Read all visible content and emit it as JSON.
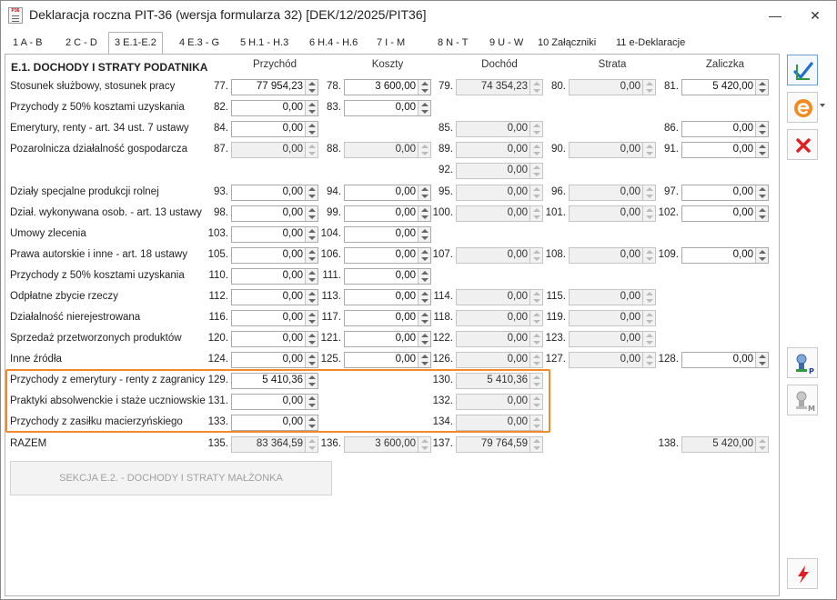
{
  "window": {
    "title": "Deklaracja roczna PIT-36 (wersja formularza 32) [DEK/12/2025/PIT36]",
    "app_icon_text": "P36",
    "minimize_glyph": "—",
    "close_glyph": "✕"
  },
  "tabs": [
    "1 A - B",
    "2 C - D",
    "3 E.1-E.2",
    "4 E.3 - G",
    "5 H.1 - H.3",
    "6 H.4 - H.6",
    "7 I - M",
    "8 N - T",
    "9 U - W",
    "10 Załączniki",
    "11 e-Deklaracje"
  ],
  "active_tab": 2,
  "section_title": "E.1. DOCHODY I STRATY PODATNIKA",
  "columns": [
    "Przychód",
    "Koszty",
    "Dochód",
    "Strata",
    "Zaliczka"
  ],
  "rows": [
    {
      "label": "Stosunek służbowy, stosunek pracy",
      "c": [
        [
          "77.",
          "77 954,23",
          0
        ],
        [
          "78.",
          "3 600,00",
          0
        ],
        [
          "79.",
          "74 354,23",
          1
        ],
        [
          "80.",
          "0,00",
          1
        ],
        [
          "81.",
          "5 420,00",
          0
        ]
      ]
    },
    {
      "label": "Przychody z 50% kosztami uzyskania",
      "c": [
        [
          "82.",
          "0,00",
          0
        ],
        [
          "83.",
          "0,00",
          0
        ],
        null,
        null,
        null
      ]
    },
    {
      "label": "Emerytury, renty - art. 34 ust. 7 ustawy",
      "c": [
        [
          "84.",
          "0,00",
          0
        ],
        null,
        [
          "85.",
          "0,00",
          1
        ],
        null,
        [
          "86.",
          "0,00",
          0
        ]
      ]
    },
    {
      "label": "Pozarolnicza działalność gospodarcza",
      "c": [
        [
          "87.",
          "0,00",
          1
        ],
        [
          "88.",
          "0,00",
          1
        ],
        [
          "89.",
          "0,00",
          1
        ],
        [
          "90.",
          "0,00",
          1
        ],
        [
          "91.",
          "0,00",
          0
        ]
      ]
    },
    {
      "label": "",
      "c": [
        null,
        null,
        [
          "92.",
          "0,00",
          1
        ],
        null,
        null
      ]
    },
    {
      "label": "Działy specjalne produkcji rolnej",
      "c": [
        [
          "93.",
          "0,00",
          0
        ],
        [
          "94.",
          "0,00",
          0
        ],
        [
          "95.",
          "0,00",
          1
        ],
        [
          "96.",
          "0,00",
          1
        ],
        [
          "97.",
          "0,00",
          0
        ]
      ]
    },
    {
      "label": "Dział. wykonywana osob. - art. 13 ustawy",
      "c": [
        [
          "98.",
          "0,00",
          0
        ],
        [
          "99.",
          "0,00",
          0
        ],
        [
          "100.",
          "0,00",
          1
        ],
        [
          "101.",
          "0,00",
          1
        ],
        [
          "102.",
          "0,00",
          0
        ]
      ]
    },
    {
      "label": "Umowy zlecenia",
      "c": [
        [
          "103.",
          "0,00",
          0
        ],
        [
          "104.",
          "0,00",
          0
        ],
        null,
        null,
        null
      ]
    },
    {
      "label": "Prawa autorskie i inne - art. 18 ustawy",
      "c": [
        [
          "105.",
          "0,00",
          0
        ],
        [
          "106.",
          "0,00",
          0
        ],
        [
          "107.",
          "0,00",
          1
        ],
        [
          "108.",
          "0,00",
          1
        ],
        [
          "109.",
          "0,00",
          0
        ]
      ]
    },
    {
      "label": "Przychody z 50% kosztami uzyskania",
      "c": [
        [
          "110.",
          "0,00",
          0
        ],
        [
          "111.",
          "0,00",
          0
        ],
        null,
        null,
        null
      ]
    },
    {
      "label": "Odpłatne zbycie rzeczy",
      "c": [
        [
          "112.",
          "0,00",
          0
        ],
        [
          "113.",
          "0,00",
          0
        ],
        [
          "114.",
          "0,00",
          1
        ],
        [
          "115.",
          "0,00",
          1
        ],
        null
      ]
    },
    {
      "label": "Działalność nierejestrowana",
      "c": [
        [
          "116.",
          "0,00",
          0
        ],
        [
          "117.",
          "0,00",
          0
        ],
        [
          "118.",
          "0,00",
          1
        ],
        [
          "119.",
          "0,00",
          1
        ],
        null
      ]
    },
    {
      "label": "Sprzedaż przetworzonych produktów",
      "c": [
        [
          "120.",
          "0,00",
          0
        ],
        [
          "121.",
          "0,00",
          0
        ],
        [
          "122.",
          "0,00",
          1
        ],
        [
          "123.",
          "0,00",
          1
        ],
        null
      ]
    },
    {
      "label": "Inne źródła",
      "c": [
        [
          "124.",
          "0,00",
          0
        ],
        [
          "125.",
          "0,00",
          0
        ],
        [
          "126.",
          "0,00",
          1
        ],
        [
          "127.",
          "0,00",
          1
        ],
        [
          "128.",
          "0,00",
          0
        ]
      ]
    },
    {
      "label": "Przychody z emerytury - renty z zagranicy",
      "c": [
        [
          "129.",
          "5 410,36",
          0
        ],
        null,
        [
          "130.",
          "5 410,36",
          1
        ],
        null,
        null
      ]
    },
    {
      "label": "Praktyki absolwenckie i staże uczniowskie",
      "c": [
        [
          "131.",
          "0,00",
          0
        ],
        null,
        [
          "132.",
          "0,00",
          1
        ],
        null,
        null
      ]
    },
    {
      "label": "Przychody z zasiłku macierzyńskiego",
      "c": [
        [
          "133.",
          "0,00",
          0
        ],
        null,
        [
          "134.",
          "0,00",
          1
        ],
        null,
        null
      ]
    },
    {
      "label": "RAZEM",
      "c": [
        [
          "135.",
          "83 364,59",
          1
        ],
        [
          "136.",
          "3 600,00",
          1
        ],
        [
          "137.",
          "79 764,59",
          1
        ],
        null,
        [
          "138.",
          "5 420,00",
          1
        ]
      ]
    }
  ],
  "spouse_button": "SEKCJA E.2. - DOCHODY I STRATY MAŁŻONKA",
  "colors": {
    "highlight": "#f08a2b",
    "accent": "#6d9bd6",
    "delete": "#e02020"
  },
  "sidebar_icons": [
    "save-check-icon",
    "e-declaration-icon",
    "cancel-icon",
    "stamp-p-icon",
    "stamp-m-icon",
    "lightning-icon"
  ]
}
